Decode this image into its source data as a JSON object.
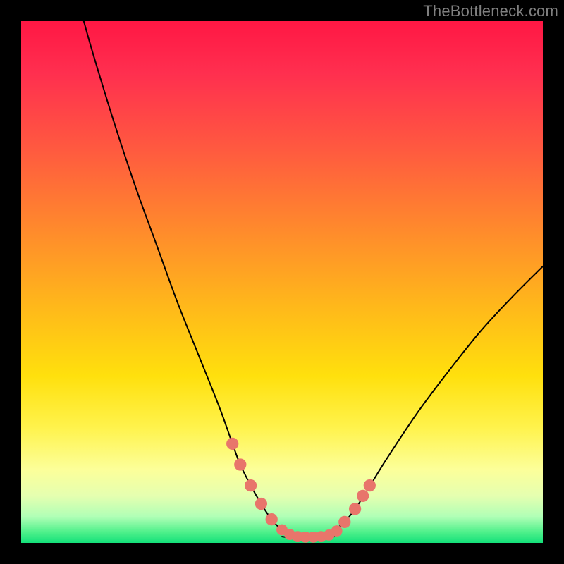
{
  "watermark": "TheBottleneck.com",
  "colors": {
    "page_bg": "#000000",
    "curve_stroke": "#000000",
    "marker_fill": "#e8756b",
    "marker_stroke": "#e8756b"
  },
  "chart_data": {
    "type": "line",
    "title": "",
    "xlabel": "",
    "ylabel": "",
    "xlim": [
      0,
      100
    ],
    "ylim": [
      0,
      100
    ],
    "grid": false,
    "legend": false,
    "background_gradient": {
      "direction": "vertical",
      "stops": [
        {
          "pos": 0.0,
          "color": "#ff1744"
        },
        {
          "pos": 0.1,
          "color": "#ff2f4f"
        },
        {
          "pos": 0.25,
          "color": "#ff5b3f"
        },
        {
          "pos": 0.4,
          "color": "#ff8a2c"
        },
        {
          "pos": 0.55,
          "color": "#ffb91a"
        },
        {
          "pos": 0.68,
          "color": "#ffe00d"
        },
        {
          "pos": 0.78,
          "color": "#fff34d"
        },
        {
          "pos": 0.86,
          "color": "#fcff9a"
        },
        {
          "pos": 0.91,
          "color": "#e5ffb0"
        },
        {
          "pos": 0.95,
          "color": "#b0ffb6"
        },
        {
          "pos": 0.98,
          "color": "#4df08a"
        },
        {
          "pos": 1.0,
          "color": "#14e07a"
        }
      ]
    },
    "series": [
      {
        "name": "left_branch",
        "x": [
          12,
          14,
          18,
          22,
          26,
          30,
          34,
          38,
          40.5,
          42,
          44,
          46,
          48,
          50,
          52
        ],
        "y": [
          100,
          93,
          80,
          68,
          57,
          46,
          36,
          26,
          19,
          15,
          11,
          7.5,
          4.5,
          2.5,
          1.5
        ]
      },
      {
        "name": "right_branch",
        "x": [
          58,
          60,
          62,
          64,
          66,
          70,
          76,
          82,
          88,
          94,
          100
        ],
        "y": [
          1.5,
          2.5,
          4,
          6.5,
          9.5,
          16,
          25,
          33,
          40.5,
          47,
          53
        ]
      },
      {
        "name": "flat_bottom",
        "x": [
          50,
          52,
          54,
          56,
          58,
          60
        ],
        "y": [
          1.2,
          1.0,
          1.0,
          1.0,
          1.0,
          1.2
        ]
      }
    ],
    "markers": [
      {
        "x": 40.5,
        "y": 19,
        "r": 1.1
      },
      {
        "x": 42,
        "y": 15,
        "r": 1.1
      },
      {
        "x": 44,
        "y": 11,
        "r": 1.1
      },
      {
        "x": 46,
        "y": 7.5,
        "r": 1.1
      },
      {
        "x": 48,
        "y": 4.5,
        "r": 1.1
      },
      {
        "x": 50,
        "y": 2.5,
        "r": 1.0
      },
      {
        "x": 51.5,
        "y": 1.6,
        "r": 1.0
      },
      {
        "x": 53,
        "y": 1.2,
        "r": 1.0
      },
      {
        "x": 54.5,
        "y": 1.1,
        "r": 1.0
      },
      {
        "x": 56,
        "y": 1.1,
        "r": 1.0
      },
      {
        "x": 57.5,
        "y": 1.2,
        "r": 1.0
      },
      {
        "x": 59,
        "y": 1.5,
        "r": 1.0
      },
      {
        "x": 60.5,
        "y": 2.3,
        "r": 1.0
      },
      {
        "x": 62,
        "y": 4,
        "r": 1.1
      },
      {
        "x": 64,
        "y": 6.5,
        "r": 1.1
      },
      {
        "x": 65.5,
        "y": 9,
        "r": 1.1
      },
      {
        "x": 66.8,
        "y": 11,
        "r": 1.1
      }
    ]
  }
}
